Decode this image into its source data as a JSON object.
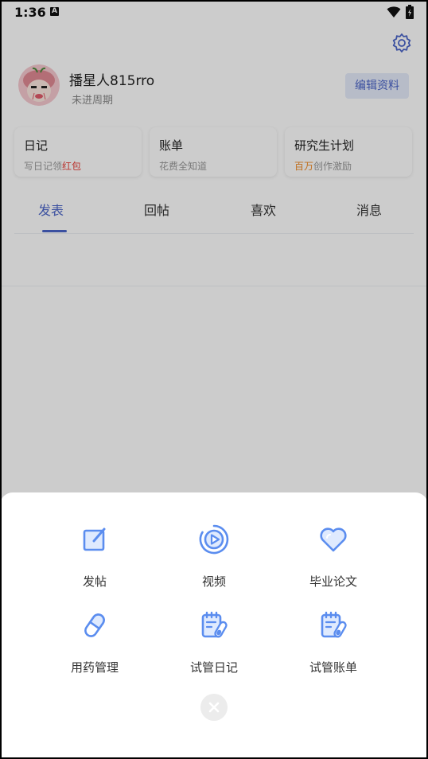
{
  "status_bar": {
    "time": "1:36",
    "notification_glyph": "A"
  },
  "header": {
    "username": "播星人815rro",
    "subtitle": "未进周期",
    "edit_button": "编辑资料"
  },
  "cards": [
    {
      "title": "日记",
      "desc_prefix": "写日记领",
      "desc_highlight": "红包",
      "desc_suffix": ""
    },
    {
      "title": "账单",
      "desc_prefix": "花费全知道",
      "desc_highlight": "",
      "desc_suffix": ""
    },
    {
      "title": "研究生计划",
      "desc_prefix": "",
      "desc_highlight": "百万",
      "desc_suffix": "创作激励"
    }
  ],
  "tabs": [
    {
      "label": "发表",
      "active": true
    },
    {
      "label": "回帖",
      "active": false
    },
    {
      "label": "喜欢",
      "active": false
    },
    {
      "label": "消息",
      "active": false
    }
  ],
  "sheet": {
    "items": [
      {
        "label": "发帖",
        "icon": "edit-icon"
      },
      {
        "label": "视频",
        "icon": "video-play-icon"
      },
      {
        "label": "毕业论文",
        "icon": "heart-icon"
      },
      {
        "label": "用药管理",
        "icon": "pill-icon"
      },
      {
        "label": "试管日记",
        "icon": "test-tube-diary-icon"
      },
      {
        "label": "试管账单",
        "icon": "test-tube-bill-icon"
      }
    ],
    "close_icon": "close-icon"
  },
  "colors": {
    "accent": "#4a64c8",
    "icon_blue": "#5b8def",
    "highlight_red": "#e8403a",
    "highlight_orange": "#f08a24"
  }
}
